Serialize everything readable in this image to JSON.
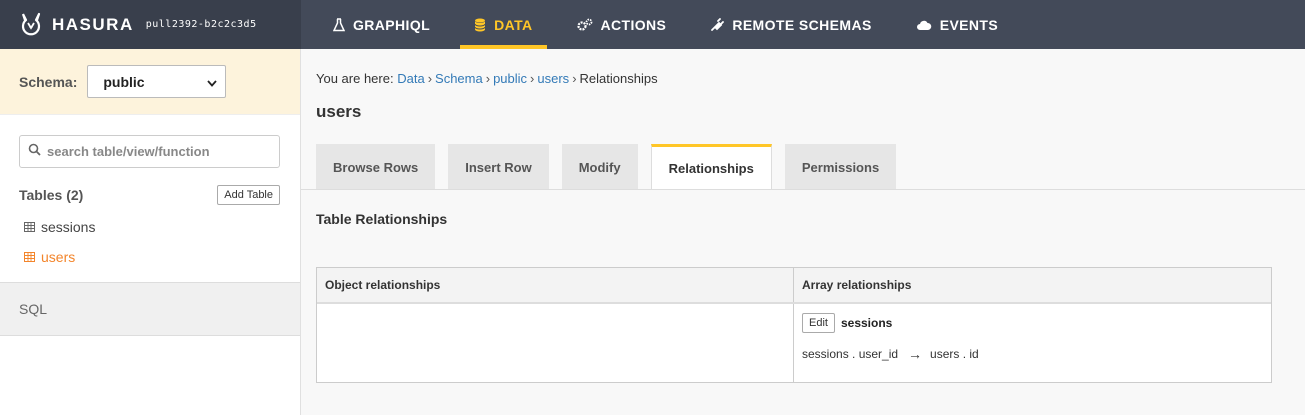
{
  "brand": {
    "name": "HASURA",
    "version": "pull2392-b2c2c3d5"
  },
  "nav": {
    "tabs": [
      {
        "label": "GRAPHIQL",
        "icon": "flask-icon"
      },
      {
        "label": "DATA",
        "icon": "database-icon",
        "active": true
      },
      {
        "label": "ACTIONS",
        "icon": "cogs-icon"
      },
      {
        "label": "REMOTE SCHEMAS",
        "icon": "plug-icon"
      },
      {
        "label": "EVENTS",
        "icon": "cloud-icon"
      }
    ]
  },
  "sidebar": {
    "schema_label": "Schema:",
    "schema_value": "public",
    "search_placeholder": "search table/view/function",
    "tables_title": "Tables (2)",
    "add_table_label": "Add Table",
    "tables": [
      {
        "name": "sessions",
        "active": false
      },
      {
        "name": "users",
        "active": true
      }
    ],
    "sql_label": "SQL"
  },
  "main": {
    "breadcrumb": {
      "prefix": "You are here:",
      "items": [
        "Data",
        "Schema",
        "public",
        "users"
      ],
      "current": "Relationships"
    },
    "title": "users",
    "tabs": [
      "Browse Rows",
      "Insert Row",
      "Modify",
      "Relationships",
      "Permissions"
    ],
    "active_tab": "Relationships",
    "section_title": "Table Relationships",
    "relationships": {
      "object_header": "Object relationships",
      "array_header": "Array relationships",
      "array_items": [
        {
          "edit_label": "Edit",
          "name": "sessions",
          "from": "sessions . user_id",
          "arrow": "→",
          "to": "users . id"
        }
      ]
    }
  },
  "colors": {
    "navbar": "#434a59",
    "accent": "#ffc627",
    "active_table": "#f3852b",
    "link": "#337ab7"
  }
}
